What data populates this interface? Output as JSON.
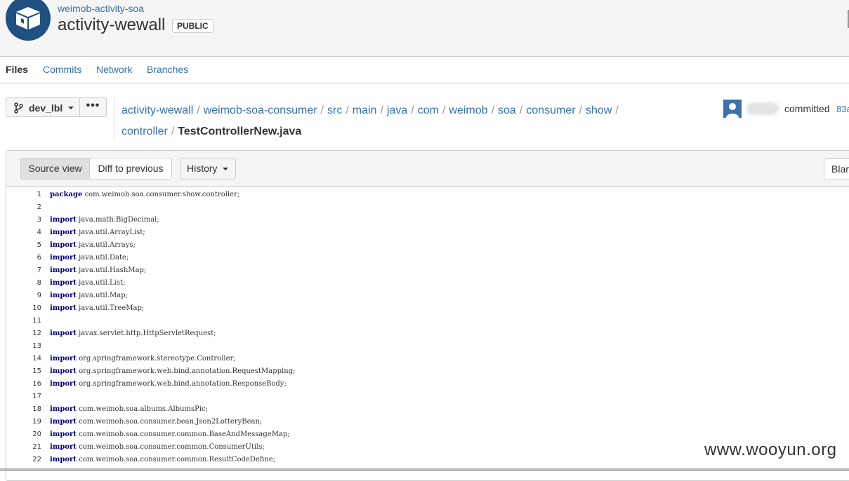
{
  "header": {
    "project": "weimob-activity-soa",
    "repo": "activity-wewall",
    "badge": "PUBLIC"
  },
  "tabs": [
    {
      "label": "Files",
      "active": true
    },
    {
      "label": "Commits",
      "active": false
    },
    {
      "label": "Network",
      "active": false
    },
    {
      "label": "Branches",
      "active": false
    }
  ],
  "branch": {
    "label": "dev_lbl",
    "more_label": "•••"
  },
  "breadcrumb": {
    "segments": [
      "activity-wewall",
      "weimob-soa-consumer",
      "src",
      "main",
      "java",
      "com",
      "weimob",
      "soa",
      "consumer",
      "show",
      "controller"
    ],
    "current": "TestControllerNew.java"
  },
  "commit": {
    "text": "committed",
    "hash": "83a"
  },
  "toolbar": {
    "source_view": "Source view",
    "diff": "Diff to previous",
    "history": "History",
    "blame": "Blame"
  },
  "code": [
    {
      "n": "1",
      "kw": "package",
      "rest": " com.weimob.soa.consumer.show.controller;"
    },
    {
      "n": "2",
      "kw": "",
      "rest": ""
    },
    {
      "n": "3",
      "kw": "import",
      "rest": " java.math.BigDecimal;"
    },
    {
      "n": "4",
      "kw": "import",
      "rest": " java.util.ArrayList;"
    },
    {
      "n": "5",
      "kw": "import",
      "rest": " java.util.Arrays;"
    },
    {
      "n": "6",
      "kw": "import",
      "rest": " java.util.Date;"
    },
    {
      "n": "7",
      "kw": "import",
      "rest": " java.util.HashMap;"
    },
    {
      "n": "8",
      "kw": "import",
      "rest": " java.util.List;"
    },
    {
      "n": "9",
      "kw": "import",
      "rest": " java.util.Map;"
    },
    {
      "n": "10",
      "kw": "import",
      "rest": " java.util.TreeMap;"
    },
    {
      "n": "11",
      "kw": "",
      "rest": ""
    },
    {
      "n": "12",
      "kw": "import",
      "rest": " javax.servlet.http.HttpServletRequest;"
    },
    {
      "n": "13",
      "kw": "",
      "rest": ""
    },
    {
      "n": "14",
      "kw": "import",
      "rest": " org.springframework.stereotype.Controller;"
    },
    {
      "n": "15",
      "kw": "import",
      "rest": " org.springframework.web.bind.annotation.RequestMapping;"
    },
    {
      "n": "16",
      "kw": "import",
      "rest": " org.springframework.web.bind.annotation.ResponseBody;"
    },
    {
      "n": "17",
      "kw": "",
      "rest": ""
    },
    {
      "n": "18",
      "kw": "import",
      "rest": " com.weimob.soa.albums.AlbumsPic;"
    },
    {
      "n": "19",
      "kw": "import",
      "rest": " com.weimob.soa.consumer.bean.Json2LotteryBean;"
    },
    {
      "n": "20",
      "kw": "import",
      "rest": " com.weimob.soa.consumer.common.BaseAndMessageMap;"
    },
    {
      "n": "21",
      "kw": "import",
      "rest": " com.weimob.soa.consumer.common.ConsumerUtils;"
    },
    {
      "n": "22",
      "kw": "import",
      "rest": " com.weimob.soa.consumer.common.ResultCodeDefine;"
    }
  ],
  "watermark": "www.wooyun.org"
}
